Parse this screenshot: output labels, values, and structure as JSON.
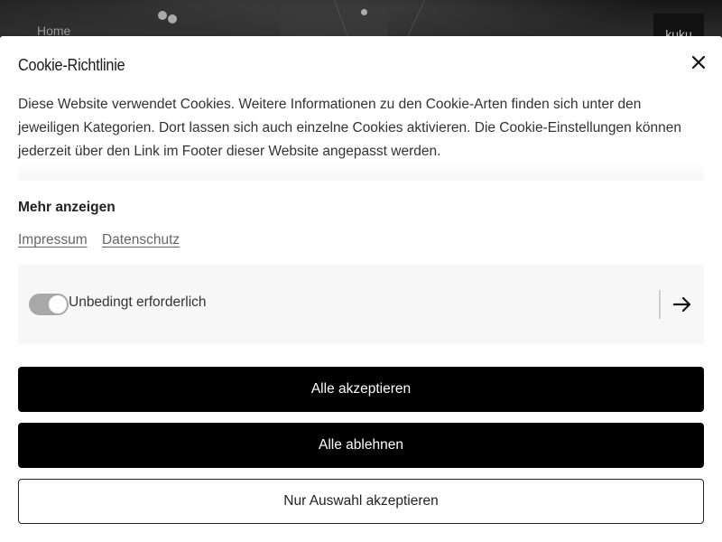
{
  "background": {
    "nav_home": "Home",
    "logo_text": "kuku"
  },
  "modal": {
    "title": "Cookie-Richtlinie",
    "close_icon": "close-icon",
    "description": "Diese Website verwendet Cookies. Weitere Informationen zu den Cookie-Arten finden sich unter den jeweiligen Kategorien. Dort lassen sich auch einzelne Cookies aktivieren. Die Cookie-Einstellungen können jederzeit über den Link im Footer dieser Website angepasst werden.",
    "show_more": "Mehr anzeigen",
    "links": {
      "imprint": "Impressum",
      "privacy": "Datenschutz"
    },
    "category": {
      "label": "Unbedingt erforderlich",
      "toggle_state": "on-disabled",
      "arrow_icon": "arrow-right-icon"
    },
    "buttons": {
      "accept_all": "Alle akzeptieren",
      "reject_all": "Alle ablehnen",
      "accept_selection": "Nur Auswahl akzeptieren"
    }
  },
  "colors": {
    "primary_button": "#000000",
    "category_bg": "#f7f7f7",
    "toggle_track": "#a8a8a8"
  }
}
